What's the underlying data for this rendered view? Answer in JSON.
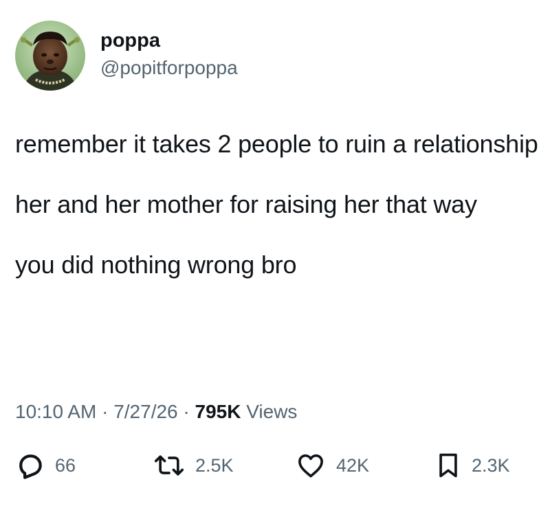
{
  "user": {
    "display_name": "poppa",
    "handle": "@popitforpoppa"
  },
  "tweet": {
    "paragraphs": [
      "remember it takes 2 people to ruin a relationship",
      "her and her mother for raising her that way",
      "you did nothing wrong bro"
    ],
    "time": "10:10 AM",
    "separator": "·",
    "date": "7/27/26",
    "views_count": "795K",
    "views_label": "Views"
  },
  "actions": {
    "replies": "66",
    "reposts": "2.5K",
    "likes": "42K",
    "bookmarks": "2.3K"
  },
  "icons": {
    "reply": "comment-bubble-icon",
    "repost": "retweet-arrows-icon",
    "like": "heart-icon",
    "bookmark": "bookmark-icon"
  },
  "colors": {
    "text_primary": "#0f1419",
    "text_secondary": "#536471",
    "background": "#ffffff"
  }
}
